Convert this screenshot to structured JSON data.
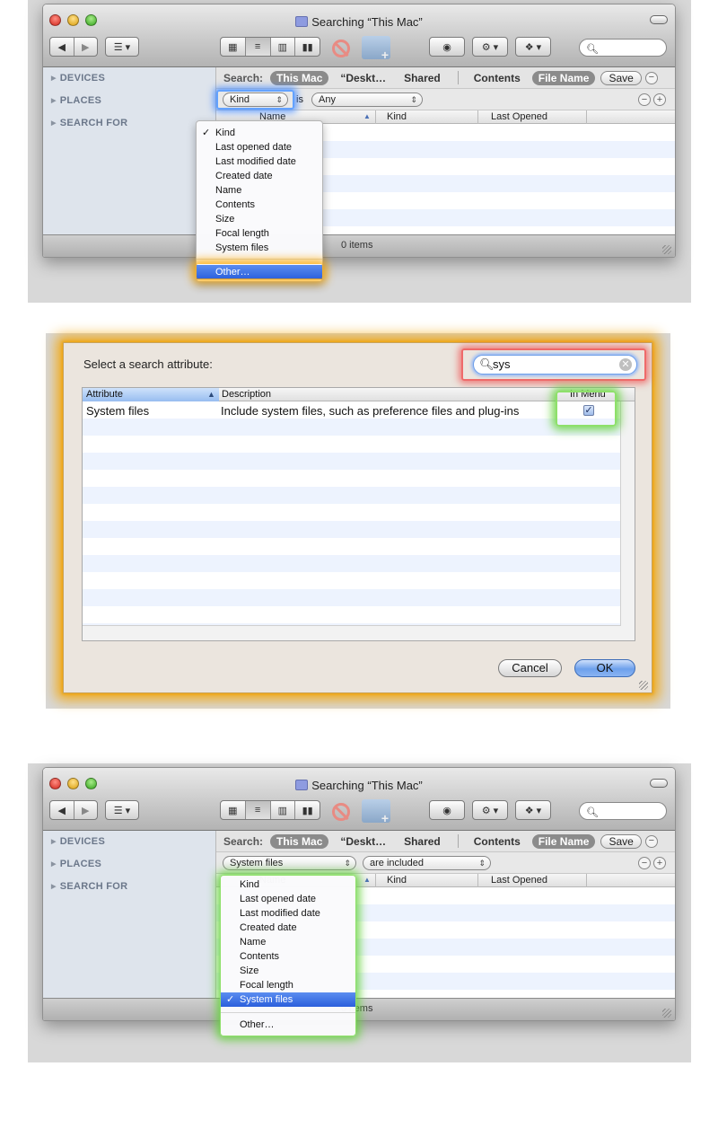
{
  "window": {
    "title": "Searching “This Mac”",
    "sidebar": {
      "devices": "DEVICES",
      "places": "PLACES",
      "search_for": "SEARCH FOR"
    },
    "scope": {
      "label": "Search:",
      "this_mac": "This Mac",
      "desktop": "“Deskt…",
      "shared": "Shared",
      "contents": "Contents",
      "file_name": "File Name",
      "save": "Save"
    },
    "columns": {
      "name": "Name",
      "kind": "Kind",
      "last_opened": "Last Opened"
    },
    "status": "0 items"
  },
  "panel1": {
    "criterion": {
      "attribute": "Kind",
      "operator": "is",
      "value": "Any"
    },
    "menu_items": [
      "Kind",
      "Last opened date",
      "Last modified date",
      "Created date",
      "Name",
      "Contents",
      "Size",
      "Focal length",
      "System files"
    ],
    "checked_index": 0,
    "other": "Other…"
  },
  "sheet": {
    "title": "Select a search attribute:",
    "search_value": "sys",
    "columns": {
      "attribute": "Attribute",
      "description": "Description",
      "in_menu": "In Menu"
    },
    "rows": [
      {
        "attribute": "System files",
        "description": "Include system files, such as preference files and plug-ins",
        "in_menu": true
      }
    ],
    "cancel": "Cancel",
    "ok": "OK"
  },
  "panel3": {
    "criterion": {
      "attribute": "System files",
      "value": "are included"
    },
    "menu_items": [
      "Kind",
      "Last opened date",
      "Last modified date",
      "Created date",
      "Name",
      "Contents",
      "Size",
      "Focal length",
      "System files"
    ],
    "checked_index": 8,
    "other": "Other…"
  },
  "colors": {
    "highlight_blue": "#63a2ff",
    "highlight_orange": "#ffaa00",
    "highlight_green": "#8ee06a",
    "highlight_red": "#ef6a6a"
  }
}
